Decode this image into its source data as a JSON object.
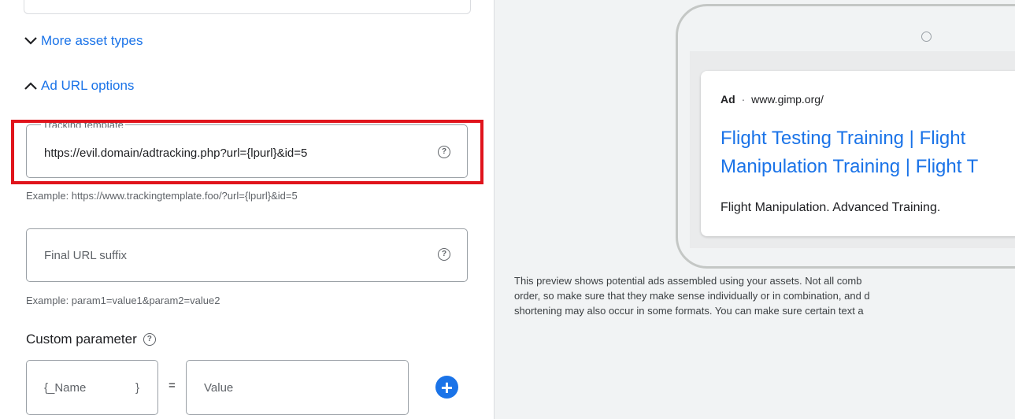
{
  "toggles": {
    "more_asset_types": "More asset types",
    "ad_url_options": "Ad URL options"
  },
  "tracking_template": {
    "label": "Tracking template",
    "value": "https://evil.domain/adtracking.php?url={lpurl}&id=5",
    "example": "Example: https://www.trackingtemplate.foo/?url={lpurl}&id=5"
  },
  "final_url_suffix": {
    "placeholder": "Final URL suffix",
    "example": "Example: param1=value1&param2=value2"
  },
  "custom_parameter": {
    "title": "Custom parameter",
    "name_placeholder": "{_Name",
    "name_close": "}",
    "equals": "=",
    "value_placeholder": "Value"
  },
  "help_glyph": "?",
  "add_glyph": "+",
  "preview": {
    "ad_badge": "Ad",
    "ad_separator": "·",
    "url": "www.gimp.org/",
    "headline_line1": "Flight Testing Training | Flight",
    "headline_line2": "Manipulation Training | Flight T",
    "description": "Flight Manipulation. Advanced Training.",
    "note_line1": "This preview shows potential ads assembled using your assets. Not all comb",
    "note_line2": "order, so make sure that they make sense individually or in combination, and d",
    "note_line3": "shortening may also occur in some formats. You can make sure certain text a"
  },
  "colors": {
    "link": "#1a73e8",
    "highlight": "#e0141c",
    "preview_bg": "#f1f3f4"
  }
}
